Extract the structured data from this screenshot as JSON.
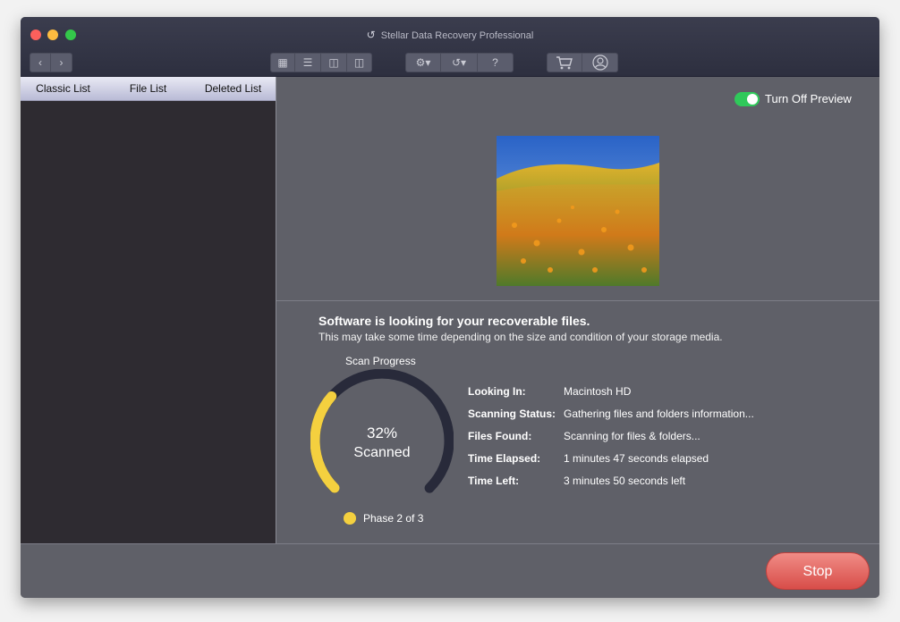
{
  "window": {
    "title": "Stellar Data Recovery Professional"
  },
  "toolbar": {
    "back_icon": "chevron-left-icon",
    "forward_icon": "chevron-right-icon",
    "view_icons": [
      "grid-view-icon",
      "list-view-icon",
      "column-view-icon",
      "coverflow-view-icon"
    ],
    "settings_icon": "gear-icon",
    "history_icon": "history-icon",
    "help_label": "?",
    "cart_icon": "cart-icon",
    "account_icon": "user-icon"
  },
  "sidebar": {
    "tabs": [
      {
        "label": "Classic List"
      },
      {
        "label": "File List"
      },
      {
        "label": "Deleted List"
      }
    ]
  },
  "preview": {
    "toggle_label": "Turn Off Preview",
    "toggle_on": true
  },
  "scan": {
    "heading": "Software is looking for your recoverable files.",
    "subheading": "This may take some time depending on the size and condition of your storage media.",
    "progress_title": "Scan Progress",
    "percent": 32,
    "percent_label": "32%",
    "scanned_label": "Scanned",
    "phase_label": "Phase 2 of 3",
    "details": [
      {
        "label": "Looking In:",
        "value": "Macintosh HD"
      },
      {
        "label": "Scanning Status:",
        "value": "Gathering files and folders information..."
      },
      {
        "label": "Files Found:",
        "value": "Scanning for files & folders..."
      },
      {
        "label": "Time Elapsed:",
        "value": "1 minutes 47 seconds elapsed"
      },
      {
        "label": "Time Left:",
        "value": "3 minutes 50 seconds left"
      }
    ]
  },
  "footer": {
    "stop_label": "Stop"
  },
  "colors": {
    "accent": "#f4d03f",
    "toggle_on": "#2fc95a",
    "stop": "#e0605b"
  }
}
